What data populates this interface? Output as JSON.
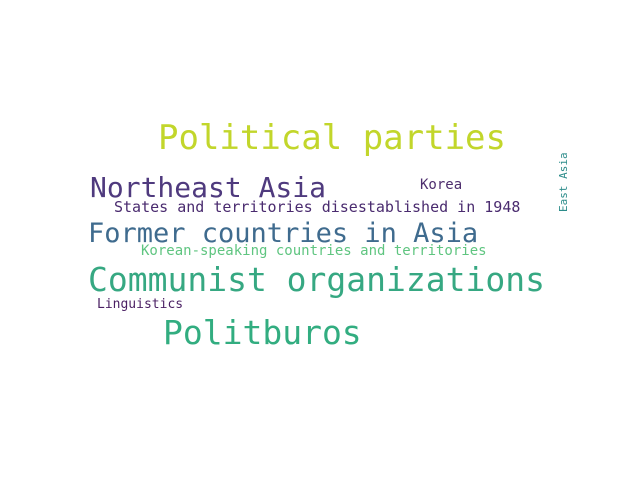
{
  "words": [
    {
      "text": "Political parties",
      "color": "#c2d62b"
    },
    {
      "text": "Northeast Asia",
      "color": "#4f3a7e"
    },
    {
      "text": "Korea",
      "color": "#4e2e6e"
    },
    {
      "text": "States and territories disestablished in 1948",
      "color": "#4a2b6f"
    },
    {
      "text": "Former countries in Asia",
      "color": "#3f6b8e"
    },
    {
      "text": "Korean-speaking countries and territories",
      "color": "#5fc580"
    },
    {
      "text": "Communist organizations",
      "color": "#36a882"
    },
    {
      "text": "Linguistics",
      "color": "#4a1f63"
    },
    {
      "text": "Politburos",
      "color": "#32ad80"
    },
    {
      "text": "East Asia",
      "color": "#2c8c8a"
    }
  ]
}
